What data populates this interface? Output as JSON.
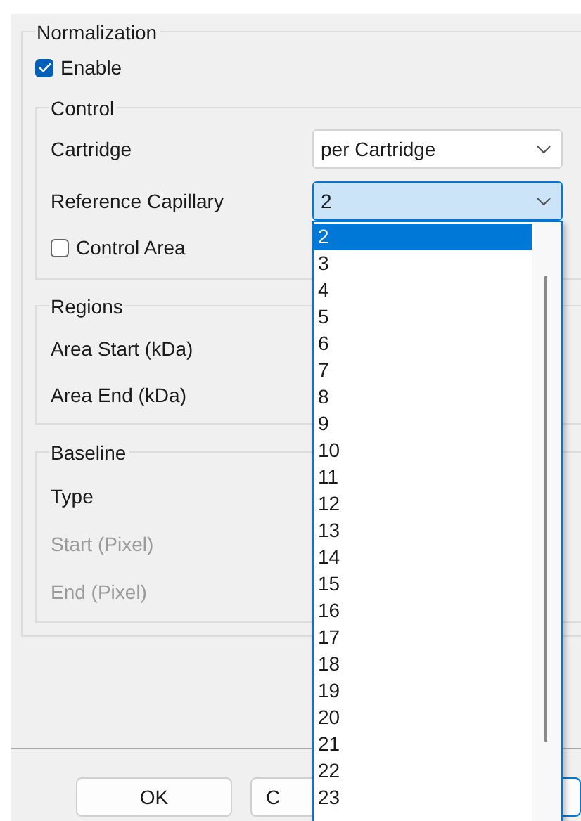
{
  "group": {
    "title": "Normalization",
    "enable": {
      "label": "Enable",
      "checked": true
    },
    "sections": [
      {
        "title": "Control",
        "rows": [
          {
            "kind": "combo",
            "label": "Cartridge",
            "value": "per Cartridge",
            "open": false
          },
          {
            "kind": "combo",
            "label": "Reference Capillary",
            "value": "2",
            "open": true
          },
          {
            "kind": "checkbox",
            "label": "Control Area",
            "checked": false
          }
        ]
      },
      {
        "title": "Regions",
        "rows": [
          {
            "kind": "label",
            "label": "Area Start (kDa)",
            "disabled": false
          },
          {
            "kind": "label",
            "label": "Area End (kDa)",
            "disabled": false
          }
        ]
      },
      {
        "title": "Baseline",
        "rows": [
          {
            "kind": "label",
            "label": "Type",
            "disabled": false
          },
          {
            "kind": "label",
            "label": "Start (Pixel)",
            "disabled": true
          },
          {
            "kind": "label",
            "label": "End (Pixel)",
            "disabled": true
          }
        ]
      }
    ]
  },
  "dropdown": {
    "items": [
      {
        "label": "2",
        "selected": true
      },
      {
        "label": "3",
        "selected": false
      },
      {
        "label": "4",
        "selected": false
      },
      {
        "label": "5",
        "selected": false
      },
      {
        "label": "6",
        "selected": false
      },
      {
        "label": "7",
        "selected": false
      },
      {
        "label": "8",
        "selected": false
      },
      {
        "label": "9",
        "selected": false
      },
      {
        "label": "10",
        "selected": false
      },
      {
        "label": "11",
        "selected": false
      },
      {
        "label": "12",
        "selected": false
      },
      {
        "label": "13",
        "selected": false
      },
      {
        "label": "14",
        "selected": false
      },
      {
        "label": "15",
        "selected": false
      },
      {
        "label": "16",
        "selected": false
      },
      {
        "label": "17",
        "selected": false
      },
      {
        "label": "18",
        "selected": false
      },
      {
        "label": "19",
        "selected": false
      },
      {
        "label": "20",
        "selected": false
      },
      {
        "label": "21",
        "selected": false
      },
      {
        "label": "22",
        "selected": false
      },
      {
        "label": "23",
        "selected": false
      }
    ]
  },
  "buttons": [
    {
      "label": "OK",
      "default": false
    },
    {
      "label": "C",
      "default": false
    },
    {
      "default": true
    }
  ]
}
